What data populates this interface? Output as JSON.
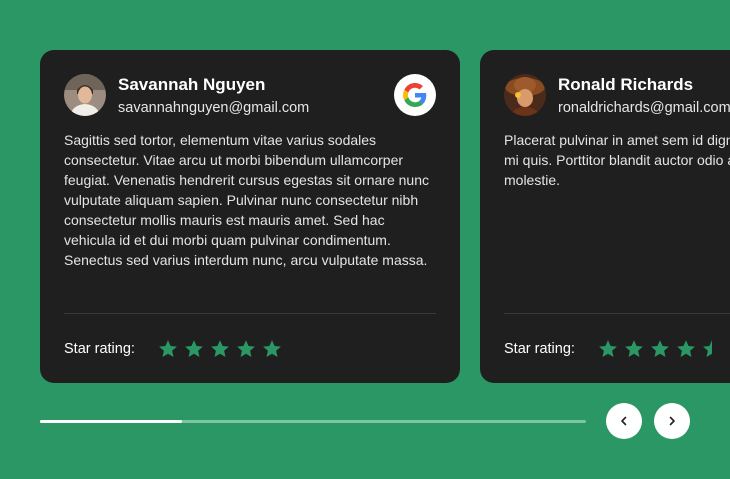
{
  "colors": {
    "background": "#2a9765",
    "card": "#1f1f1f",
    "star": "#2a9765"
  },
  "reviews": [
    {
      "name": "Savannah Nguyen",
      "email": "savannahnguyen@gmail.com",
      "text": "Sagittis sed tortor, elementum vitae varius sodales consectetur. Vitae arcu ut morbi bibendum ullamcorper feugiat. Venenatis hendrerit cursus egestas sit ornare nunc vulputate aliquam sapien. Pulvinar nunc consectetur nibh consectetur mollis mauris est mauris amet. Sed hac vehicula id et dui morbi quam pulvinar condimentum. Senectus sed varius interdum nunc, arcu vulputate massa.",
      "rating_label": "Star rating:",
      "rating": 5,
      "source_icon": "google-icon"
    },
    {
      "name": "Ronald Richards",
      "email": "ronaldrichards@gmail.com",
      "text": "Placerat pulvinar in amet sem id dignissim est pellentesque mi quis. Porttitor blandit auctor odio a ornare bibendum molestie.",
      "rating_label": "Star rating:",
      "rating": 4.5
    }
  ],
  "slider": {
    "progress": 0.26
  },
  "nav": {
    "prev_icon": "chevron-left-icon",
    "next_icon": "chevron-right-icon"
  }
}
